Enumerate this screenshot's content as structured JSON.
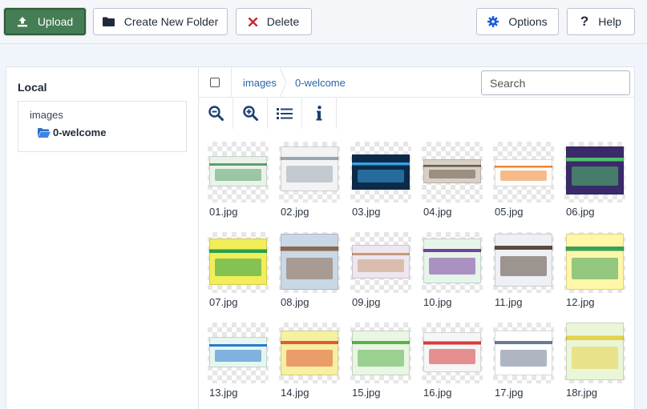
{
  "toolbar": {
    "upload_label": "Upload",
    "new_folder_label": "Create New Folder",
    "delete_label": "Delete",
    "options_label": "Options",
    "help_label": "Help"
  },
  "sidebar": {
    "title": "Local",
    "tree": {
      "root": "images",
      "child": "0-welcome"
    }
  },
  "breadcrumb": [
    "images",
    "0-welcome"
  ],
  "search": {
    "placeholder": "Search",
    "value": ""
  },
  "view_buttons": [
    "zoom-out-icon",
    "zoom-in-icon",
    "list-view-icon",
    "info-icon"
  ],
  "colors": {
    "upload": "#457d54",
    "accent": "#2a67a8",
    "options_icon": "#1a5bd6",
    "delete_icon": "#c22a2a"
  },
  "files": [
    {
      "name": "01.jpg",
      "bg": "#eaf3ea",
      "accent": "#5aa16a"
    },
    {
      "name": "02.jpg",
      "bg": "#f3f3f3",
      "accent": "#9aa6b4"
    },
    {
      "name": "03.jpg",
      "bg": "#0c2b4a",
      "accent": "#3aa0e0"
    },
    {
      "name": "04.jpg",
      "bg": "#d7d0c6",
      "accent": "#6a5a4a"
    },
    {
      "name": "05.jpg",
      "bg": "#ffffff",
      "accent": "#f0832c"
    },
    {
      "name": "06.jpg",
      "bg": "#3a2a6a",
      "accent": "#4ec06a"
    },
    {
      "name": "07.jpg",
      "bg": "#f2ee5a",
      "accent": "#2aa04a"
    },
    {
      "name": "08.jpg",
      "bg": "#c9d8e6",
      "accent": "#8a6a50"
    },
    {
      "name": "09.jpg",
      "bg": "#efe6f0",
      "accent": "#c79a7a"
    },
    {
      "name": "10.jpg",
      "bg": "#e6f5ea",
      "accent": "#7a3ea0"
    },
    {
      "name": "11.jpg",
      "bg": "#eef0f6",
      "accent": "#5a4a3a"
    },
    {
      "name": "12.jpg",
      "bg": "#fff6a8",
      "accent": "#3aa05a"
    },
    {
      "name": "13.jpg",
      "bg": "#e6f6f0",
      "accent": "#2a7ad0"
    },
    {
      "name": "14.jpg",
      "bg": "#f6f0a0",
      "accent": "#e05a3a"
    },
    {
      "name": "15.jpg",
      "bg": "#e9f6e4",
      "accent": "#5ab04a"
    },
    {
      "name": "16.jpg",
      "bg": "#f6f6f6",
      "accent": "#d83a3a"
    },
    {
      "name": "17.jpg",
      "bg": "#ffffff",
      "accent": "#6a7a90"
    },
    {
      "name": "18r.jpg",
      "bg": "#eaf6d8",
      "accent": "#e6d24a"
    }
  ]
}
